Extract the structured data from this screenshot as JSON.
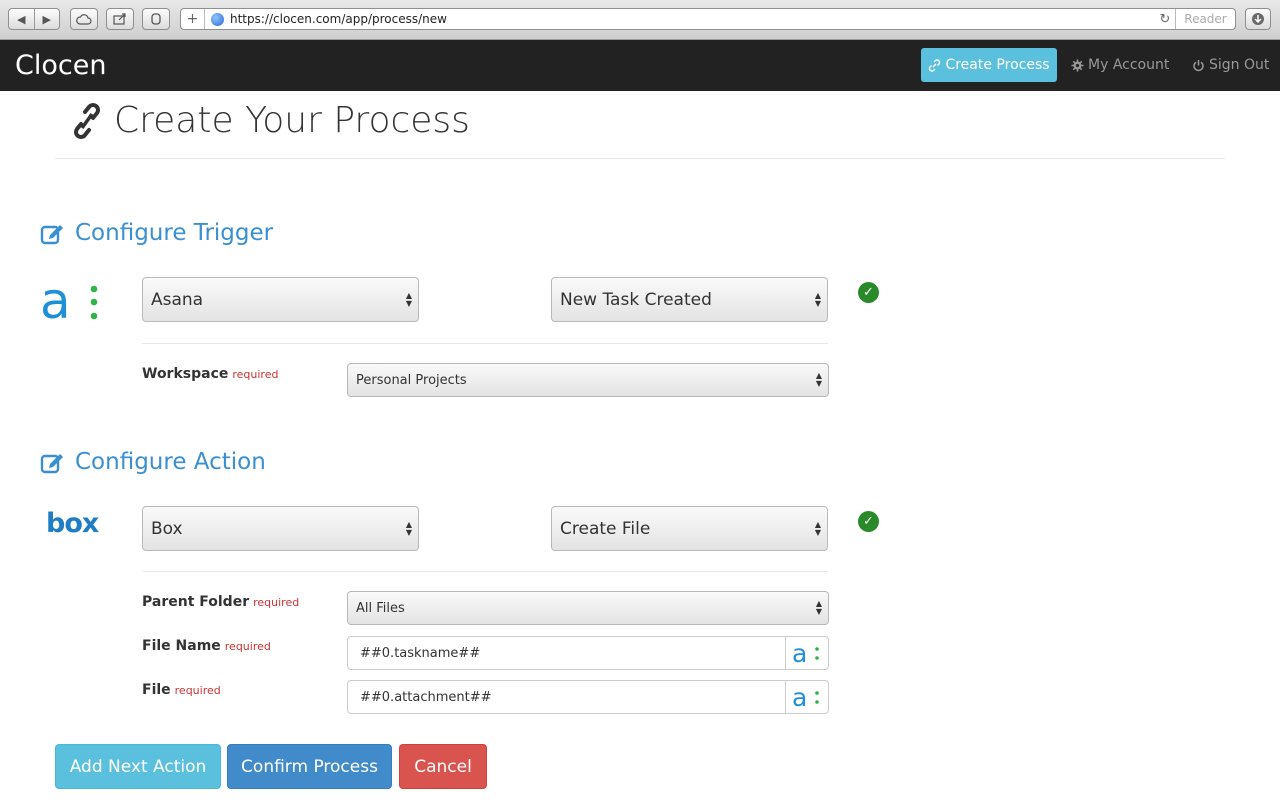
{
  "browser": {
    "url": "https://clocen.com/app/process/new",
    "reader_label": "Reader"
  },
  "navbar": {
    "brand": "Clocen",
    "create_process": "Create Process",
    "my_account": "My Account",
    "sign_out": "Sign Out"
  },
  "page": {
    "title": "Create Your Process"
  },
  "trigger": {
    "heading": "Configure Trigger",
    "app_select": "Asana",
    "event_select": "New Task Created",
    "fields": [
      {
        "label": "Workspace",
        "required": "required",
        "value": "Personal Projects"
      }
    ]
  },
  "action": {
    "heading": "Configure Action",
    "app_logo_text": "box",
    "app_select": "Box",
    "event_select": "Create File",
    "fields": [
      {
        "label": "Parent Folder",
        "required": "required",
        "value": "All Files"
      },
      {
        "label": "File Name",
        "required": "required",
        "value": "##0.taskname##"
      },
      {
        "label": "File",
        "required": "required",
        "value": "##0.attachment##"
      }
    ]
  },
  "buttons": {
    "add_next_action": "Add Next Action",
    "confirm_process": "Confirm Process",
    "cancel": "Cancel"
  },
  "colors": {
    "accent": "#3a8fd0",
    "info": "#5bc0de",
    "primary": "#428bca",
    "danger": "#d9534f",
    "success": "#2a8a2a",
    "asana_blue": "#1f8fd6",
    "asana_green": "#2fb34a"
  }
}
